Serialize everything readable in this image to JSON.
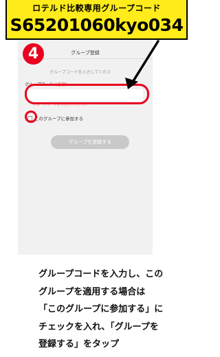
{
  "banner": {
    "label": "ロテルド比較専用グループコード",
    "code": "S65201060kyo034"
  },
  "step_number": "4",
  "app": {
    "title": "グループ登録",
    "hint": "グループコードを入力してくださ",
    "field_label": "グループコード",
    "required_tag": "(必須)",
    "input_placeholder": "",
    "error_hint": "グループコードを入力してください",
    "join_label": "このグループに参加する",
    "register_button": "グループを登録する"
  },
  "instructions": [
    "グループコードを入力し、この",
    "グループを適用する場合は",
    "「このグループに参加する」に",
    "チェックを入れ、「グループを",
    "登録する」をタップ"
  ],
  "colors": {
    "banner_bg": "#ffec1a",
    "annotation_red": "#e8001e",
    "screen_bg": "#f1f1f1",
    "button_disabled": "#c9c9c9"
  }
}
